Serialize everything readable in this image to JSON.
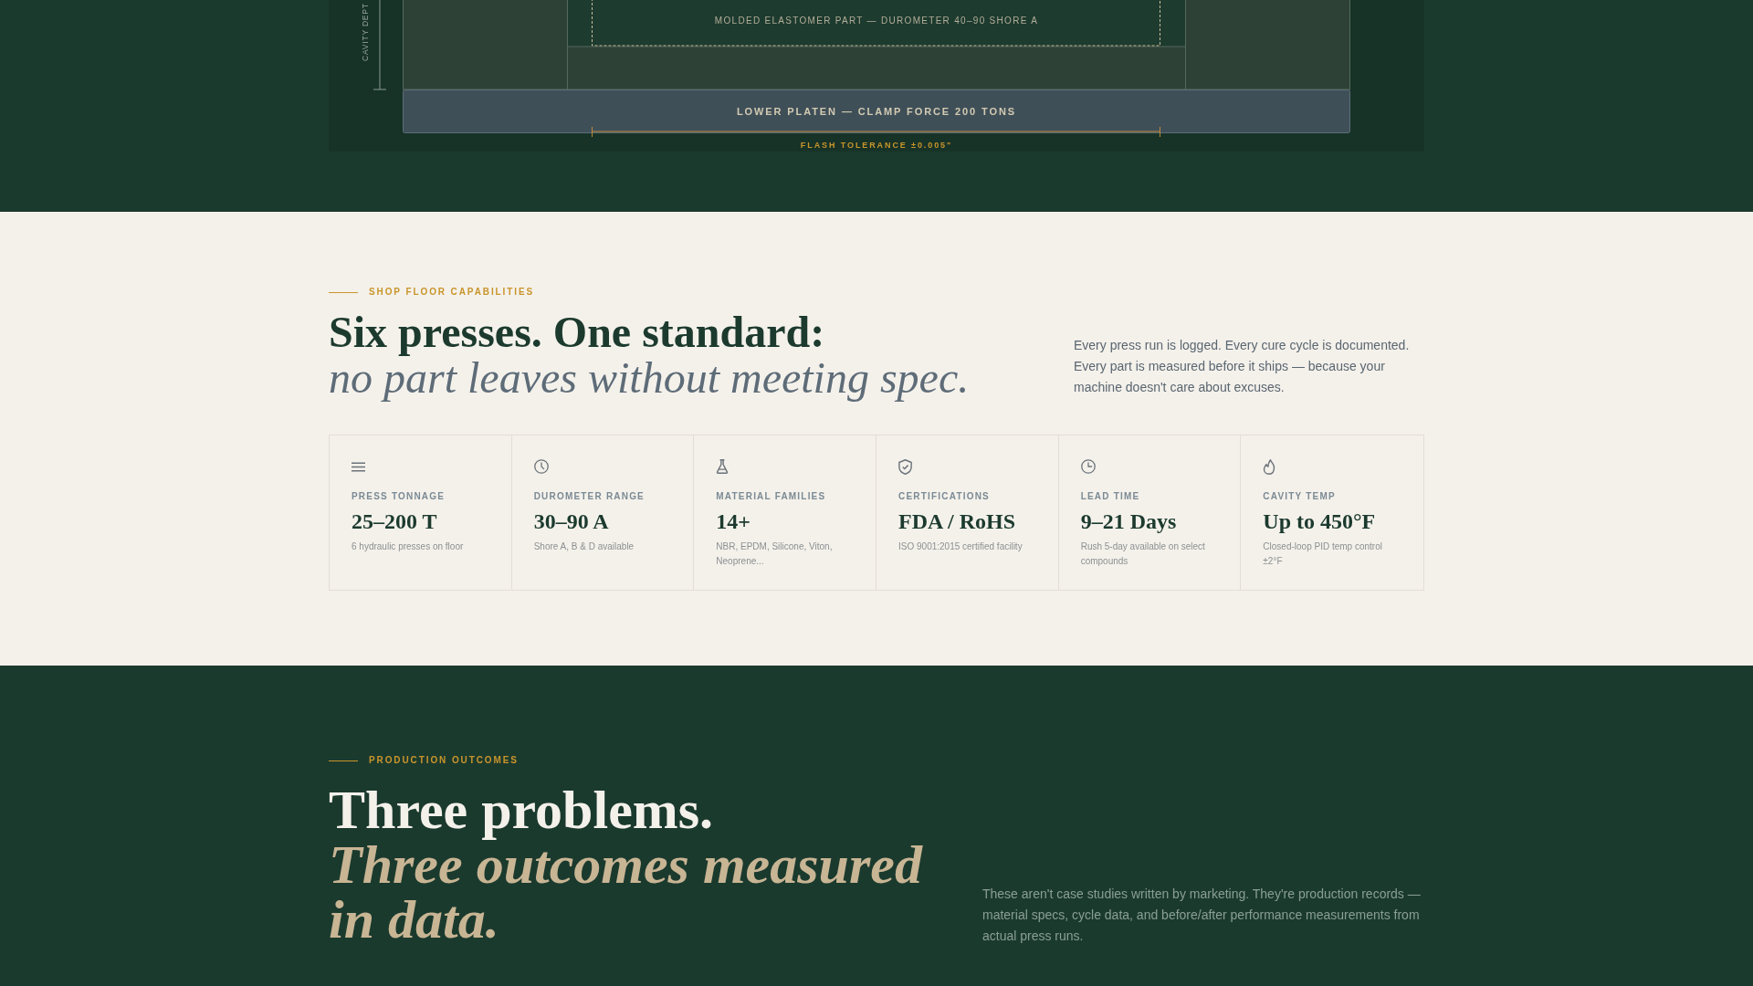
{
  "diagram": {
    "cavity_label": "CAVITY DEPT",
    "part_label": "MOLDED ELASTOMER PART — DUROMETER 40–90 SHORE A",
    "platen_label": "LOWER PLATEN — CLAMP FORCE 200 TONS",
    "tolerance_label": "FLASH TOLERANCE ±0.005\""
  },
  "capabilities": {
    "eyebrow": "SHOP FLOOR CAPABILITIES",
    "heading": "Six presses. One standard: *no part leaves without meeting spec.*",
    "intro": "Every press run is logged. Every cure cycle is documented. Every part is measured before it ships — because your machine doesn't care about excuses.",
    "cards": [
      {
        "label": "PRESS TONNAGE",
        "value": "25–200 T",
        "detail": "6 hydraulic presses on floor"
      },
      {
        "label": "DUROMETER RANGE",
        "value": "30–90 A",
        "detail": "Shore A, B & D available"
      },
      {
        "label": "MATERIAL FAMILIES",
        "value": "14+",
        "detail": "NBR, EPDM, Silicone, Viton, Neoprene..."
      },
      {
        "label": "CERTIFICATIONS",
        "value": "FDA / RoHS",
        "detail": "ISO 9001:2015 certified facility"
      },
      {
        "label": "LEAD TIME",
        "value": "9–21 Days",
        "detail": "Rush 5-day available on select compounds"
      },
      {
        "label": "CAVITY TEMP",
        "value": "Up to 450°F",
        "detail": "Closed-loop PID temp control ±2°F"
      }
    ]
  },
  "outcomes": {
    "eyebrow": "PRODUCTION OUTCOMES",
    "heading": "Three problems. *Three outcomes measured in data.*",
    "intro": "These aren't case studies written by marketing. They're production records — material specs, cycle data, and before/after performance measurements from actual press runs."
  }
}
